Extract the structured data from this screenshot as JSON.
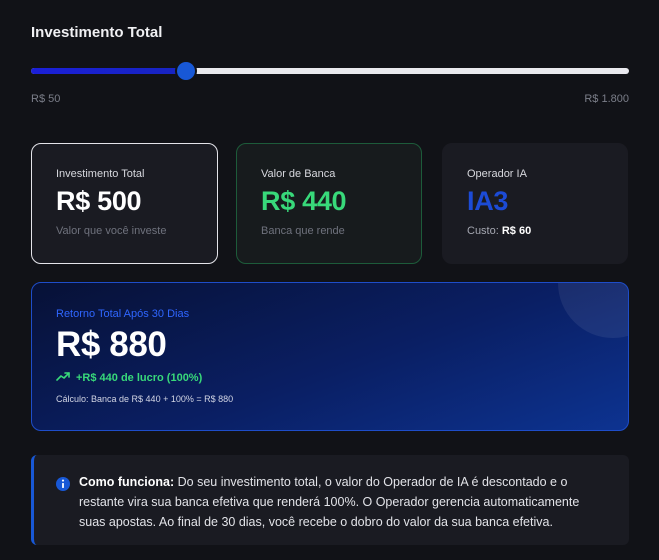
{
  "header": {
    "title": "Investimento Total"
  },
  "slider": {
    "min_label": "R$ 50",
    "max_label": "R$ 1.800",
    "fraction": 0.26
  },
  "cards": {
    "investimento": {
      "label": "Investimento Total",
      "value": "R$ 500",
      "subtitle": "Valor que você investe"
    },
    "banca": {
      "label": "Valor de Banca",
      "value": "R$ 440",
      "subtitle": "Banca que rende"
    },
    "operador": {
      "label": "Operador IA",
      "value": "IA3",
      "cost_label": "Custo:",
      "cost_value": "R$ 60"
    }
  },
  "retorno": {
    "label": "Retorno Total Após 30 Dias",
    "value": "R$ 880",
    "lucro": "+R$ 440 de lucro (100%)",
    "calculo": "Cálculo: Banca de R$ 440 + 100% = R$ 880"
  },
  "info": {
    "title": "Como funciona:",
    "text": " Do seu investimento total, o valor do Operador de IA é descontado e o restante vira sua banca efetiva que renderá 100%. O Operador gerencia automaticamente suas apostas. Ao final de 30 dias, você recebe o dobro do valor da sua banca efetiva."
  },
  "colors": {
    "accent": "#1858d6",
    "green": "#38d97a",
    "operator_blue": "#1c4bd6",
    "background": "#111217"
  },
  "icons": {
    "trend": "trending-up-icon",
    "info": "info-icon"
  }
}
